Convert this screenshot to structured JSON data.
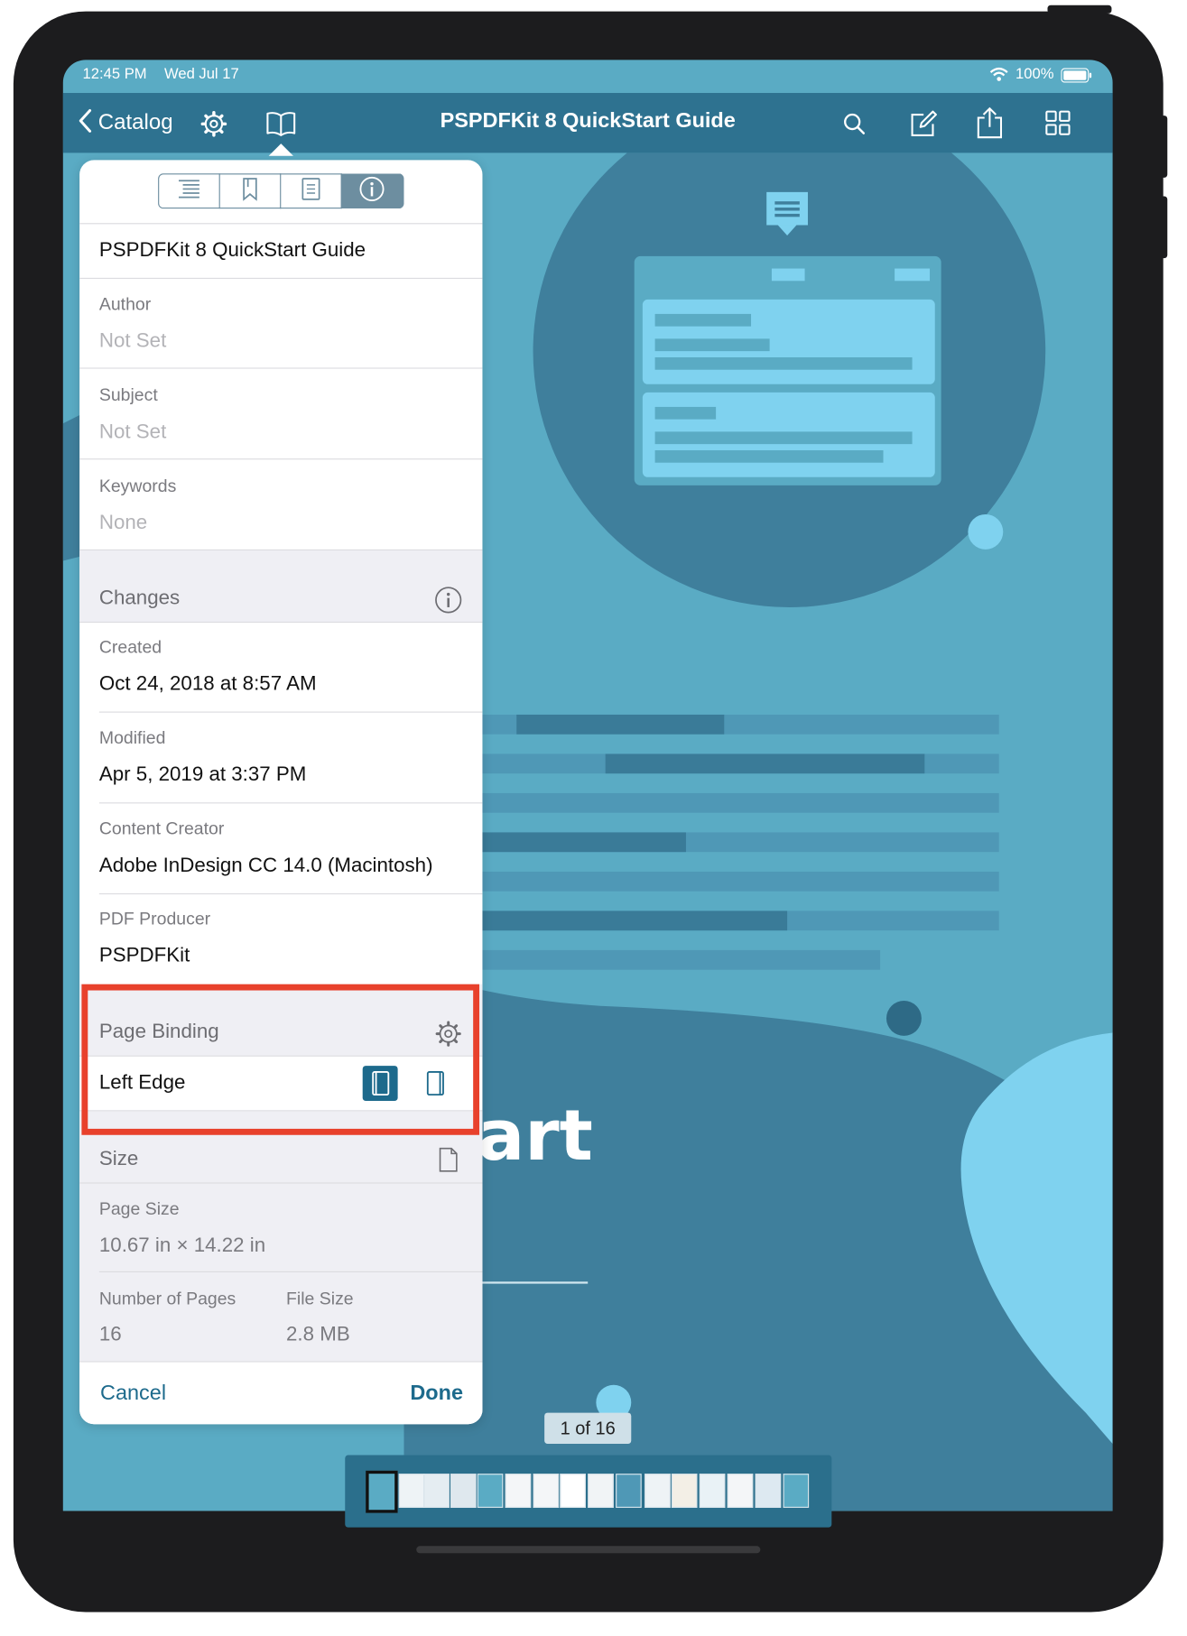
{
  "status_bar": {
    "time": "12:45 PM",
    "date": "Wed Jul 17",
    "battery": "100%"
  },
  "nav": {
    "back_label": "Catalog",
    "title": "PSPDFKit 8 QuickStart Guide",
    "icons": [
      "chevron-left-icon",
      "gear-icon",
      "book-icon",
      "search-icon",
      "edit-icon",
      "share-icon",
      "grid-icon"
    ]
  },
  "popover": {
    "tabs": [
      "outline-icon",
      "bookmark-icon",
      "annotations-icon",
      "info-icon"
    ],
    "selected_tab": "info-icon",
    "document_title": "PSPDFKit 8 QuickStart Guide",
    "metadata": [
      {
        "label": "Author",
        "value": "Not Set"
      },
      {
        "label": "Subject",
        "value": "Not Set"
      },
      {
        "label": "Keywords",
        "value": "None"
      }
    ],
    "changes": {
      "header": "Changes",
      "created_label": "Created",
      "created_value": "Oct 24, 2018 at 8:57 AM",
      "modified_label": "Modified",
      "modified_value": "Apr 5, 2019 at 3:37 PM",
      "creator_label": "Content Creator",
      "creator_value": "Adobe InDesign CC 14.0 (Macintosh)",
      "producer_label": "PDF Producer",
      "producer_value": "PSPDFKit"
    },
    "page_binding": {
      "header": "Page Binding",
      "value": "Left Edge",
      "selected": "left"
    },
    "size": {
      "header": "Size",
      "page_size_label": "Page Size",
      "page_size_value": "10.67 in × 14.22 in",
      "pages_label": "Number of Pages",
      "pages_value": "16",
      "file_size_label": "File Size",
      "file_size_value": "2.8 MB"
    },
    "cancel_label": "Cancel",
    "done_label": "Done"
  },
  "document": {
    "visible_title_fragment": "art"
  },
  "page_indicator": "1 of 16",
  "thumbnails": {
    "count": 16,
    "current": 1
  },
  "colors": {
    "accent": "#1d6a8c",
    "nav_bar": "#2e7290",
    "page_bg": "#5aabc4",
    "highlight": "#e8412c"
  }
}
